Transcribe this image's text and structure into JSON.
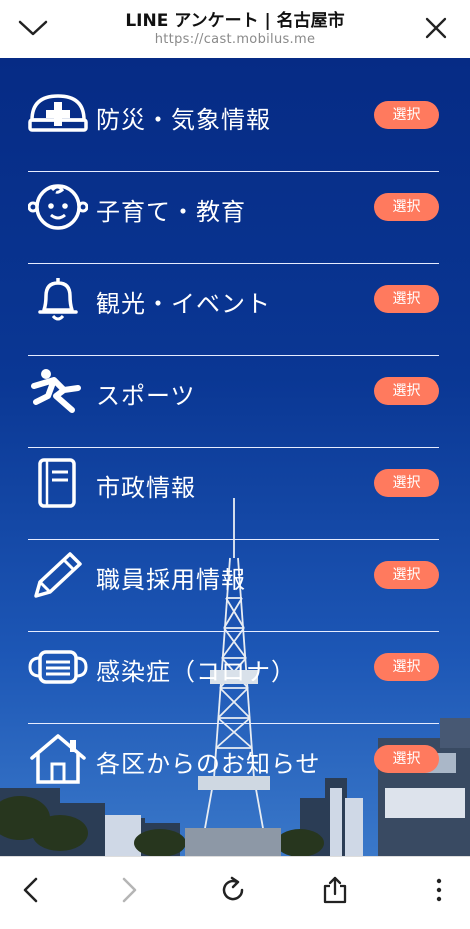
{
  "header": {
    "title": "LINE アンケート | 名古屋市",
    "url": "https://cast.mobilus.me"
  },
  "menu": {
    "items": [
      {
        "label": "防災・気象情報",
        "button": "選択",
        "icon": "helmet-icon"
      },
      {
        "label": "子育て・教育",
        "button": "選択",
        "icon": "baby-face-icon"
      },
      {
        "label": "観光・イベント",
        "button": "選択",
        "icon": "bell-icon"
      },
      {
        "label": "スポーツ",
        "button": "選択",
        "icon": "runner-icon"
      },
      {
        "label": "市政情報",
        "button": "選択",
        "icon": "book-icon"
      },
      {
        "label": "職員採用情報",
        "button": "選択",
        "icon": "pencil-icon"
      },
      {
        "label": "感染症（コロナ）",
        "button": "選択",
        "icon": "mask-icon"
      },
      {
        "label": "各区からのお知らせ",
        "button": "選択",
        "icon": "house-icon"
      }
    ]
  },
  "colors": {
    "accent": "#ff7a5e",
    "background_top": "#062b85",
    "background_bottom": "#3a78c9"
  },
  "toolbar": {
    "icons": [
      "back-icon",
      "forward-icon",
      "reload-icon",
      "share-icon",
      "more-icon"
    ]
  }
}
